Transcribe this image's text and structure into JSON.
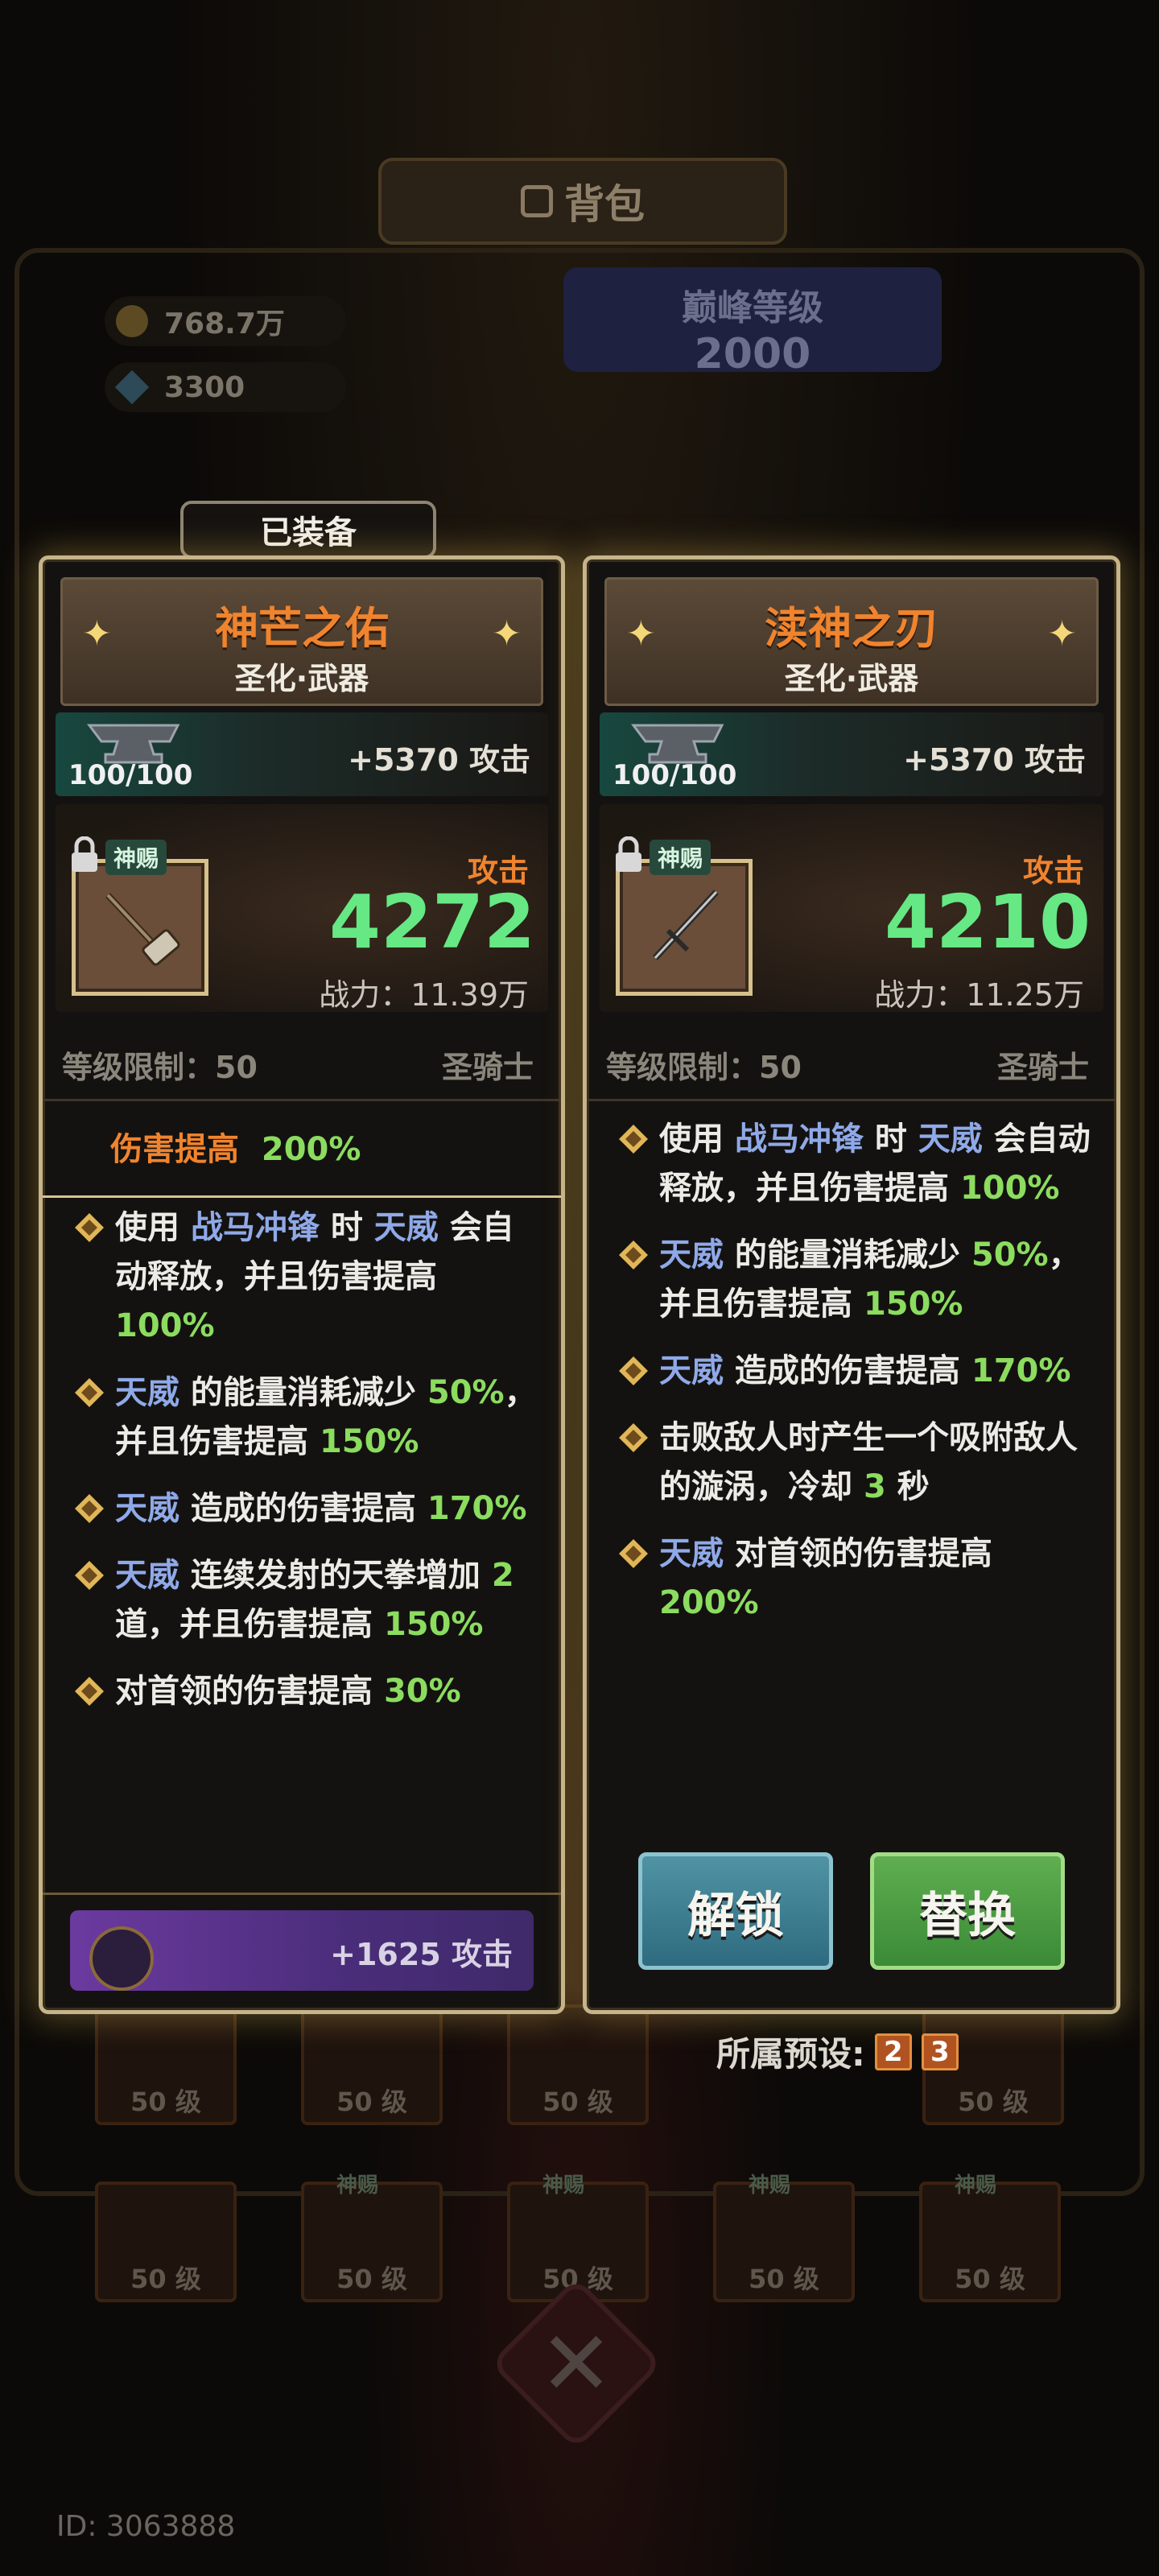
{
  "header": {
    "title": "背包"
  },
  "currency": {
    "gold": "768.7万",
    "gems": "3300"
  },
  "peak_level": {
    "label": "巅峰等级",
    "value": "2000"
  },
  "background_slots": {
    "level_label": "50 级",
    "gift_tag": "神赐"
  },
  "equipped_tab": "已装备",
  "left_card": {
    "name": "神芒之佑",
    "subtitle": "圣化·武器",
    "forge_progress": "100/100",
    "forge_bonus": "+5370 攻击",
    "gift_tag": "神赐",
    "attack_label": "攻击",
    "attack_value": "4272",
    "power": "战力：11.39万",
    "level_req": "等级限制：50",
    "class": "圣骑士",
    "damage_prefix": "伤害提高",
    "damage_value": "200%",
    "effects": [
      [
        "使用 ",
        "战马冲锋",
        " 时 ",
        "天威",
        " 会自动释放，并且伤害提高 ",
        "100%"
      ],
      [
        "",
        "天威",
        " 的能量消耗减少 ",
        "50%",
        "，并且伤害提高 ",
        "150%"
      ],
      [
        "",
        "天威",
        " 造成的伤害提高 ",
        "170%"
      ],
      [
        "",
        "天威",
        " 连续发射的天拳增加 ",
        "2",
        " 道，并且伤害提高 ",
        "150%"
      ],
      [
        "对首领的伤害提高 ",
        "30%"
      ]
    ],
    "extra_bonus": "+1625 攻击"
  },
  "right_card": {
    "name": "渎神之刃",
    "subtitle": "圣化·武器",
    "forge_progress": "100/100",
    "forge_bonus": "+5370 攻击",
    "gift_tag": "神赐",
    "attack_label": "攻击",
    "attack_value": "4210",
    "power": "战力：11.25万",
    "level_req": "等级限制：50",
    "class": "圣骑士",
    "effects_text": {
      "e1_a": "使用 ",
      "e1_b": "战马冲锋",
      "e1_c": " 时 ",
      "e1_d": "天威",
      "e1_e": " 会自动释放，并且伤害提高 ",
      "e1_f": "100%",
      "e2_a": "天威",
      "e2_b": " 的能量消耗减少 ",
      "e2_c": "50%",
      "e2_d": "，并且伤害提高 ",
      "e2_e": "150%",
      "e3_a": "天威",
      "e3_b": " 造成的伤害提高 ",
      "e3_c": "170%",
      "e4_a": "击败敌人时产生一个吸附敌人的漩涡，冷却 ",
      "e4_b": "3",
      "e4_c": " 秒",
      "e5_a": "天威",
      "e5_b": " 对首领的伤害提高 ",
      "e5_c": "200%"
    },
    "unlock_label": "解锁",
    "replace_label": "替换"
  },
  "presets": {
    "label": "所属预设:",
    "values": [
      "2",
      "3"
    ]
  },
  "user_id": "ID: 3063888",
  "colors": {
    "orange": "#f0842e",
    "green": "#66e884",
    "blue": "#8fa9e8",
    "gold_border": "#c6b48b"
  }
}
